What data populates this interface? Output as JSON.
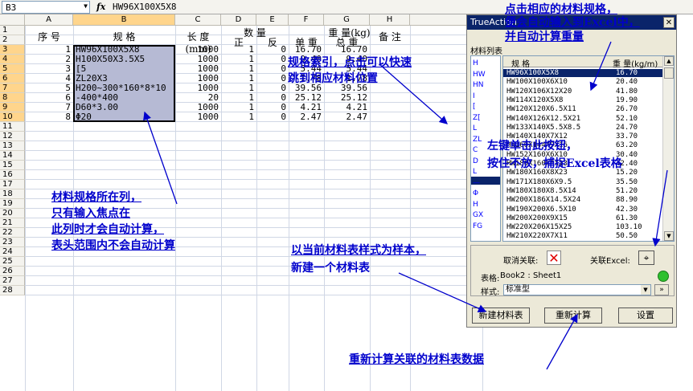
{
  "formula_bar": {
    "cell_ref": "B3",
    "fx": "fx",
    "formula": "HW96X100X5X8"
  },
  "columns": [
    "A",
    "B",
    "C",
    "D",
    "E",
    "F",
    "G",
    "H"
  ],
  "rows": [
    "1",
    "2",
    "3",
    "4",
    "5",
    "6",
    "7",
    "8",
    "9",
    "10",
    "11",
    "12",
    "13",
    "14",
    "15",
    "16",
    "17",
    "18",
    "19",
    "20",
    "21",
    "22",
    "23",
    "24",
    "25",
    "26",
    "27",
    "28"
  ],
  "headers": {
    "seq": "序 号",
    "spec": "规 格",
    "length": "长 度(mm)",
    "qty": "数  量",
    "qty_pos": "正",
    "qty_neg": "反",
    "weight": "重  量(kg)",
    "unit_weight": "单 重",
    "total_weight": "总 重",
    "note": "备 注"
  },
  "data_rows": [
    {
      "seq": "1",
      "spec": "HW96X100X5X8",
      "length": "1000",
      "pos": "1",
      "neg": "0",
      "unit": "16.70",
      "total": "16.70"
    },
    {
      "seq": "2",
      "spec": "H100X50X3.5X5",
      "length": "1000",
      "pos": "1",
      "neg": "0",
      "unit": "9.40",
      "total": "9.40"
    },
    {
      "seq": "3",
      "spec": "[5",
      "length": "1000",
      "pos": "1",
      "neg": "0",
      "unit": "5.44",
      "total": "5.44"
    },
    {
      "seq": "4",
      "spec": "ZL20X3",
      "length": "1000",
      "pos": "1",
      "neg": "0",
      "unit": "1.78",
      "total": "1.78"
    },
    {
      "seq": "5",
      "spec": "H200~300*160*8*10",
      "length": "1000",
      "pos": "1",
      "neg": "0",
      "unit": "39.56",
      "total": "39.56"
    },
    {
      "seq": "6",
      "spec": "-400*400",
      "length": "20",
      "pos": "1",
      "neg": "0",
      "unit": "25.12",
      "total": "25.12"
    },
    {
      "seq": "7",
      "spec": "D60*3.00",
      "length": "1000",
      "pos": "1",
      "neg": "0",
      "unit": "4.21",
      "total": "4.21"
    },
    {
      "seq": "8",
      "spec": "Φ20",
      "length": "1000",
      "pos": "1",
      "neg": "0",
      "unit": "2.47",
      "total": "2.47"
    }
  ],
  "panel": {
    "title": "TrueAction",
    "list_label": "材料列表",
    "index_chars": [
      "H",
      "HW",
      "HN",
      "I",
      "[",
      "Z[",
      "L",
      "ZL",
      "C",
      "D",
      "L",
      "—",
      "Φ",
      "H",
      "GX",
      "FG"
    ],
    "list_header_name": "规 格",
    "list_header_weight": "重 量(kg/m)",
    "items": [
      {
        "name": "HW96X100X5X8",
        "w": "16.70"
      },
      {
        "name": "HW100X100X6X10",
        "w": "20.40"
      },
      {
        "name": "HW120X106X12X20",
        "w": "41.80"
      },
      {
        "name": "HW114X120X5X8",
        "w": "19.90"
      },
      {
        "name": "HW120X120X6.5X11",
        "w": "26.70"
      },
      {
        "name": "HW140X126X12.5X21",
        "w": "52.10"
      },
      {
        "name": "HW133X140X5.5X8.5",
        "w": "24.70"
      },
      {
        "name": "HW140X140X7X12",
        "w": "33.70"
      },
      {
        "name": "HW160X144X9X16",
        "w": "63.20"
      },
      {
        "name": "HW152X160X6X10",
        "w": "30.40"
      },
      {
        "name": "HW180X160X6X13",
        "w": "42.40"
      },
      {
        "name": "HW180X160X8X23",
        "w": "15.20"
      },
      {
        "name": "HW171X180X6X9.5",
        "w": "35.50"
      },
      {
        "name": "HW180X180X8.5X14",
        "w": "51.20"
      },
      {
        "name": "HW200X186X14.5X24",
        "w": "88.90"
      },
      {
        "name": "HW190X200X6.5X10",
        "w": "42.30"
      },
      {
        "name": "HW200X200X9X15",
        "w": "61.30"
      },
      {
        "name": "HW220X206X15X25",
        "w": "103.10"
      },
      {
        "name": "HW210X220X7X11",
        "w": "50.50"
      }
    ],
    "cancel_label": "取消关联:",
    "link_label": "关联Excel:",
    "sheet_label": "表格:",
    "sheet_value": "Book2 : Sheet1",
    "style_label": "样式:",
    "style_value": "标准型",
    "new_table_btn": "新建材料表",
    "recalc_btn": "重新计算",
    "settings_btn": "设置"
  },
  "annotations": {
    "a1": "点击相应的材料规格，",
    "a2": "便会自动输入到Excel中，",
    "a3": "并自动计算重量",
    "b1": "规格索引，点击可以快速",
    "b2": "跳到相应材料位置",
    "c1": "左键单击此按钮，",
    "c2": "按住不放，捕捉Excel表格",
    "d1": "材料规格所在列，",
    "d2": "只有输入焦点在",
    "d3": "此列时才会自动计算，",
    "d4": "表头范围内不会自动计算",
    "e1": "以当前材料表样式为样本，",
    "e2": "新建一个材料表",
    "f1": "重新计算关联的材料表数据"
  }
}
